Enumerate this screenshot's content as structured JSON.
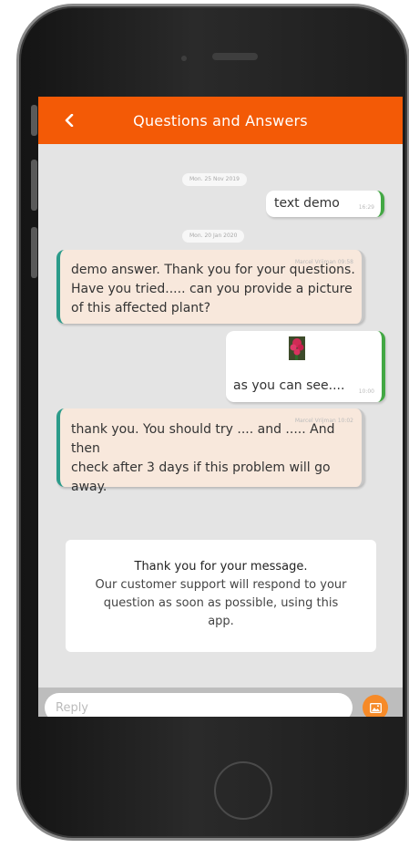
{
  "header": {
    "title": "Questions and Answers",
    "back_icon": "chevron-left-icon"
  },
  "messages": {
    "date_1": "Mon. 25 Nov 2019",
    "msg_1": {
      "text": "text demo",
      "time": "16:29"
    },
    "date_2": "Mon. 20 Jan 2020",
    "msg_2": {
      "sender": "Marcel Vrijman 09:58",
      "text": [
        "demo answer. Thank you for your questions.",
        "Have you tried..... can you provide a picture",
        "of this affected plant?"
      ]
    },
    "msg_3": {
      "text": "as you can see....",
      "time": "10:00",
      "image_icon": "flower-photo"
    },
    "msg_4": {
      "sender": "Marcel Vrijman 10:02",
      "text": [
        "thank you. You should try .... and ..... And then",
        "check after 3 days if this problem will go",
        "away."
      ]
    }
  },
  "notice": {
    "title": "Thank you for your message.",
    "body": [
      "Our customer support will respond to your",
      "question as soon as possible, using this",
      "app."
    ]
  },
  "reply": {
    "placeholder": "Reply",
    "attach_icon": "image-icon"
  },
  "colors": {
    "accent": "#f35a06",
    "incoming_bg": "#f8e8dc",
    "incoming_bar": "#2b9b8a",
    "outgoing_bar": "#43a844",
    "attach_button": "#f68a28"
  }
}
